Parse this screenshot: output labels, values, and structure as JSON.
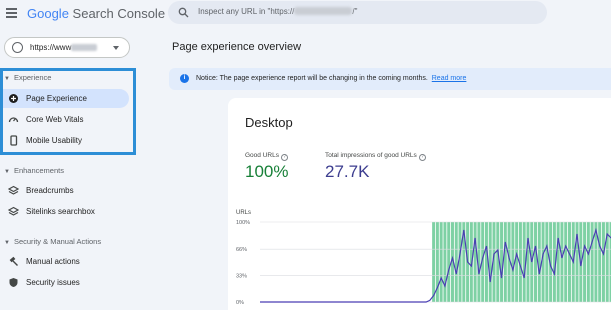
{
  "header": {
    "brand_google": "Google",
    "brand_rest": "Search Console",
    "search_placeholder_prefix": "Inspect any URL in \"https://",
    "search_placeholder_suffix": "/\""
  },
  "property": {
    "url": "https://www"
  },
  "sidebar": {
    "sections": [
      {
        "title": "Experience",
        "items": [
          {
            "label": "Page Experience",
            "icon": "page-experience-icon",
            "active": true
          },
          {
            "label": "Core Web Vitals",
            "icon": "speedometer-icon"
          },
          {
            "label": "Mobile Usability",
            "icon": "phone-icon"
          }
        ]
      },
      {
        "title": "Enhancements",
        "items": [
          {
            "label": "Breadcrumbs",
            "icon": "layers-icon"
          },
          {
            "label": "Sitelinks searchbox",
            "icon": "layers-icon"
          }
        ]
      },
      {
        "title": "Security & Manual Actions",
        "items": [
          {
            "label": "Manual actions",
            "icon": "hammer-icon"
          },
          {
            "label": "Security issues",
            "icon": "shield-icon"
          }
        ]
      }
    ]
  },
  "main": {
    "page_title": "Page experience overview",
    "notice": {
      "text": "Notice: The page experience report will be changing in the coming months.",
      "link": "Read more"
    },
    "card": {
      "title": "Desktop",
      "metrics": [
        {
          "label": "Good URLs",
          "value": "100%",
          "color": "#188038"
        },
        {
          "label": "Total impressions of good URLs",
          "value": "27.7K",
          "color": "#3c3d8f"
        }
      ]
    }
  },
  "chart_data": {
    "type": "line",
    "ylabel": "URLs",
    "yticks": [
      "100%",
      "66%",
      "33%",
      "0%"
    ],
    "ylim": [
      0,
      100
    ],
    "shaded_region_color": "#7ed1a4",
    "line_color": "#4a3fb3",
    "series": [
      {
        "values": [
          0,
          0,
          0,
          0,
          0,
          0,
          0,
          0,
          0,
          0,
          0,
          0,
          0,
          0,
          0,
          0,
          0,
          0,
          0,
          0,
          0,
          0,
          0,
          0,
          0,
          0,
          0,
          0,
          0,
          0,
          0,
          0,
          0,
          0,
          0,
          0,
          0,
          0,
          0,
          0,
          0,
          0,
          0,
          0,
          0,
          2,
          8,
          18,
          30,
          20,
          40,
          55,
          35,
          60,
          90,
          50,
          45,
          80,
          35,
          55,
          70,
          25,
          60,
          65,
          30,
          75,
          55,
          40,
          60,
          45,
          30,
          80,
          50,
          70,
          35,
          60,
          70,
          45,
          35,
          80,
          55,
          70,
          60,
          50,
          85,
          45,
          70,
          60,
          75,
          90,
          70,
          60,
          85,
          80
        ]
      }
    ],
    "shaded_from_index": 46
  }
}
